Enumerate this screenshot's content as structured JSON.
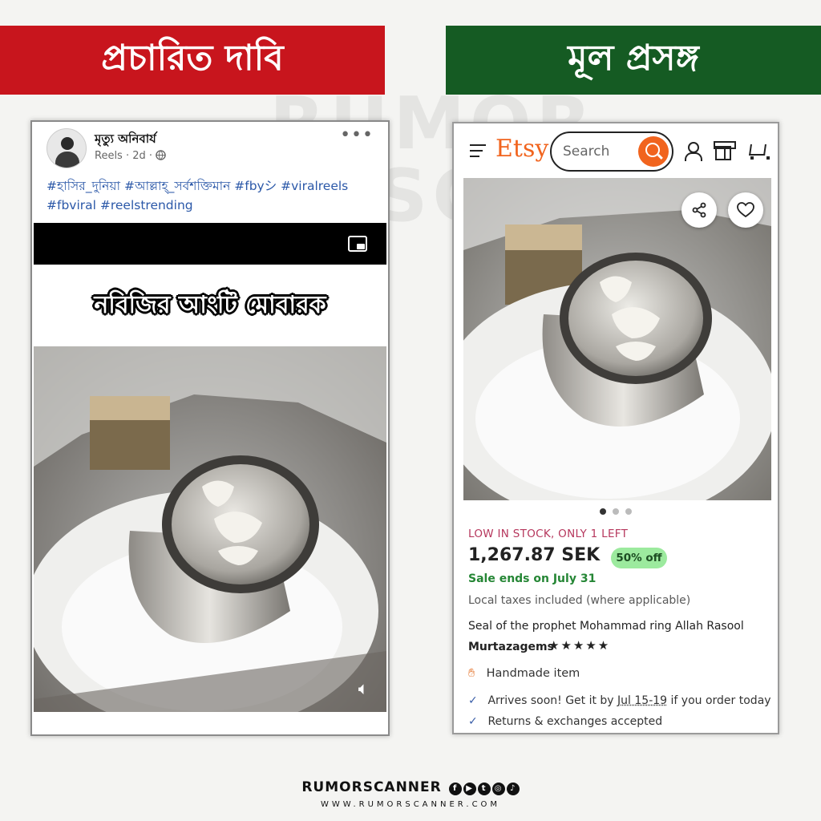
{
  "banners": {
    "left": "প্রচারিত দাবি",
    "right": "মূল প্রসঙ্গ"
  },
  "facebook_post": {
    "author": "মৃত্যু অনিবার্য",
    "meta": "Reels · 2d ·",
    "hashtags": "#হাসির_দুনিয়া #আল্লাহ্_সর্বশক্তিমান #fbyシ #viralreels #fbviral #reelstrending",
    "overlay_text": "নবিজির আংটি মোবারক",
    "icons": [
      "more-dots-icon",
      "globe-icon",
      "picture-in-picture-icon",
      "sound-icon"
    ]
  },
  "etsy": {
    "logo": "Etsy",
    "search_placeholder": "Search",
    "stock": "LOW IN STOCK, ONLY 1 LEFT",
    "price": "1,267.87 SEK",
    "discount": "50% off",
    "sale_ends": "Sale ends on July 31",
    "taxes": "Local taxes included (where applicable)",
    "title": "Seal of the prophet Mohammad ring Allah Rasool",
    "shop": "Murtazagems",
    "rating_stars": 5,
    "stars_text": "★★★★★",
    "handmade": "Handmade item",
    "arrival_pre": "Arrives soon! Get it by ",
    "arrival_date": "Jul 15-19",
    "arrival_post": " if you order today",
    "returns": "Returns & exchanges accepted",
    "carousel_dots": 3,
    "carousel_active": 1,
    "colors": {
      "brand": "#f1641e",
      "stock": "#b6375d",
      "sale": "#258635",
      "pill": "#9cea9e"
    }
  },
  "footer": {
    "brand": "RUMORSCANNER",
    "url": "WWW.RUMORSCANNER.COM"
  },
  "colors": {
    "banner_left": "#c8151d",
    "banner_right": "#155b23"
  }
}
